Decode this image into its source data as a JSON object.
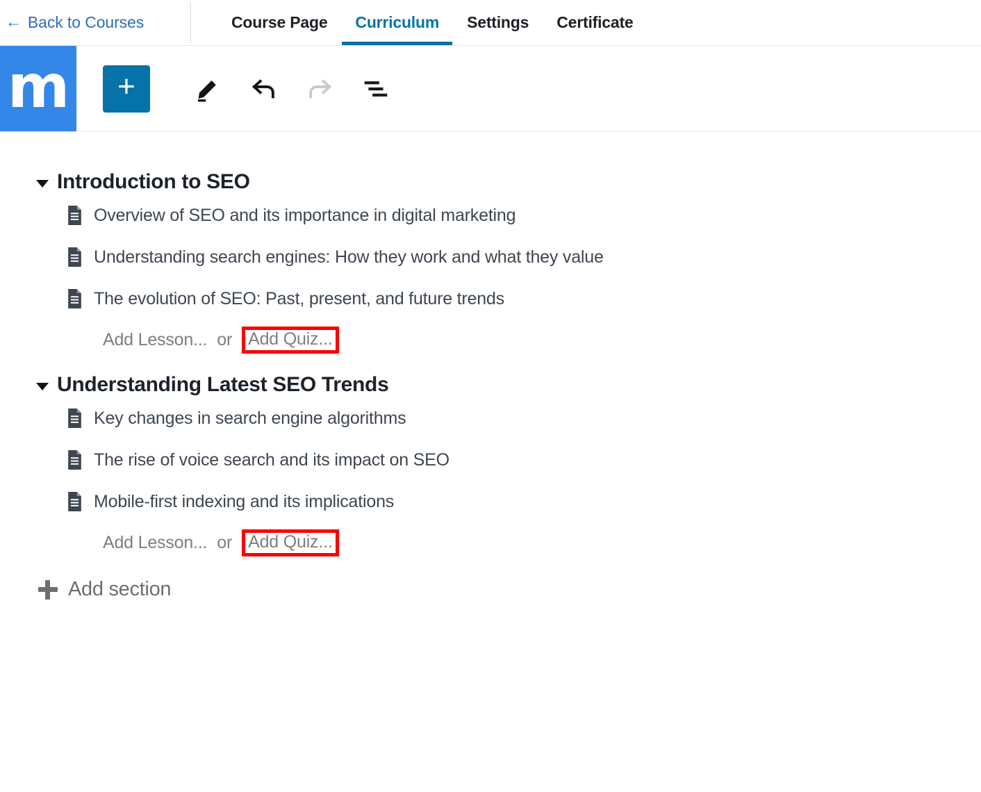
{
  "header": {
    "back_link": {
      "arrow": "←",
      "label": "Back to Courses",
      "icon": "arrow-left-icon"
    },
    "tabs": [
      {
        "label": "Course Page",
        "active": false
      },
      {
        "label": "Curriculum",
        "active": true
      },
      {
        "label": "Settings",
        "active": false
      },
      {
        "label": "Certificate",
        "active": false
      }
    ]
  },
  "branding": {
    "logo_letter": "m",
    "logo_bg": "#3387e8",
    "accent": "#0573a8",
    "link_color": "#2a6ebb"
  },
  "toolbar": {
    "add_button": {
      "label": "+",
      "icon": "plus-icon",
      "bg": "#0573a8"
    },
    "items": [
      {
        "icon": "pencil-icon",
        "enabled": true
      },
      {
        "icon": "undo-arrow-icon",
        "enabled": true
      },
      {
        "icon": "redo-arrow-icon",
        "enabled": false
      },
      {
        "icon": "sort-lines-icon",
        "enabled": true
      }
    ]
  },
  "curriculum": {
    "sections": [
      {
        "title": "Introduction to SEO",
        "expanded": true,
        "lessons": [
          {
            "title": "Overview of SEO and its importance in digital marketing",
            "icon": "document-icon"
          },
          {
            "title": "Understanding search engines: How they work and what they value",
            "icon": "document-icon"
          },
          {
            "title": "The evolution of SEO: Past, present, and future trends",
            "icon": "document-icon"
          }
        ],
        "add_lesson_label": "Add Lesson...",
        "or_label": "or",
        "add_quiz_label": "Add Quiz...",
        "quiz_highlighted": true
      },
      {
        "title": "Understanding Latest SEO Trends",
        "expanded": true,
        "lessons": [
          {
            "title": "Key changes in search engine algorithms",
            "icon": "document-icon"
          },
          {
            "title": "The rise of voice search and its impact on SEO",
            "icon": "document-icon"
          },
          {
            "title": "Mobile-first indexing and its implications",
            "icon": "document-icon"
          }
        ],
        "add_lesson_label": "Add Lesson...",
        "or_label": "or",
        "add_quiz_label": "Add Quiz...",
        "quiz_highlighted": true
      }
    ],
    "add_section_label": "Add section"
  },
  "annotation": {
    "highlight_color": "#fb0101",
    "highlight_targets": [
      "Add Quiz...",
      "Add Quiz..."
    ]
  }
}
